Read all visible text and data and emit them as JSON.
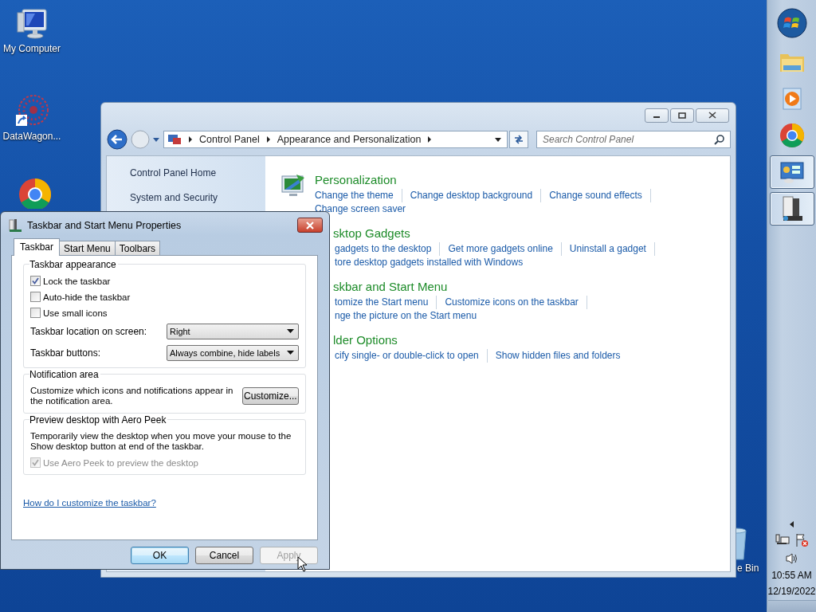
{
  "desktop": {
    "icons": [
      {
        "kind": "computer",
        "label": "My Computer"
      },
      {
        "kind": "app",
        "label": "DataWagon..."
      },
      {
        "kind": "browser"
      },
      {
        "kind": "recycle-bin",
        "label": "e Bin"
      }
    ]
  },
  "control_panel": {
    "breadcrumb": [
      "Control Panel",
      "Appearance and Personalization"
    ],
    "search": {
      "placeholder": "Search Control Panel"
    },
    "nav": [
      "Control Panel Home",
      "System and Security"
    ],
    "categories": [
      {
        "title": "Personalization",
        "cut": false,
        "rows": [
          [
            "Change the theme",
            "Change desktop background",
            "Change sound effects"
          ],
          [
            "Change screen saver"
          ]
        ]
      },
      {
        "title": "sktop Gadgets",
        "cut": true,
        "rows": [
          [
            "gadgets to the desktop",
            "Get more gadgets online",
            "Uninstall a gadget"
          ],
          [
            "tore desktop gadgets installed with Windows"
          ]
        ]
      },
      {
        "title": "skbar and Start Menu",
        "cut": true,
        "rows": [
          [
            "tomize the Start menu",
            "Customize icons on the taskbar"
          ],
          [
            "nge the picture on the Start menu"
          ]
        ]
      },
      {
        "title": "lder Options",
        "cut": true,
        "rows": [
          [
            "cify single- or double-click to open",
            "Show hidden files and folders"
          ]
        ]
      }
    ]
  },
  "dialog": {
    "title": "Taskbar and Start Menu Properties",
    "tabs": [
      {
        "label": "Taskbar",
        "selected": true
      },
      {
        "label": "Start Menu",
        "selected": false
      },
      {
        "label": "Toolbars",
        "selected": false
      }
    ],
    "appearance": {
      "title": "Taskbar appearance",
      "options": [
        {
          "label": "Lock the taskbar",
          "checked": true,
          "disabled": false
        },
        {
          "label": "Auto-hide the taskbar",
          "checked": false,
          "disabled": false
        },
        {
          "label": "Use small icons",
          "checked": false,
          "disabled": false
        }
      ],
      "dropdowns": [
        {
          "label": "Taskbar location on screen:",
          "value": "Right"
        },
        {
          "label": "Taskbar buttons:",
          "value": "Always combine, hide labels"
        }
      ]
    },
    "notification": {
      "title": "Notification area",
      "text": "Customize which icons and notifications appear in the notification area.",
      "button": "Customize..."
    },
    "peek": {
      "title": "Preview desktop with Aero Peek",
      "text": "Temporarily view the desktop when you move your mouse to the Show desktop button at end of the taskbar.",
      "option": {
        "label": "Use Aero Peek to preview the desktop",
        "checked": true,
        "disabled": true
      }
    },
    "help_link": "How do I customize the taskbar?",
    "buttons": [
      {
        "label": "OK",
        "default": true,
        "disabled": false
      },
      {
        "label": "Cancel",
        "default": false,
        "disabled": false
      },
      {
        "label": "Apply",
        "default": false,
        "disabled": true
      }
    ]
  },
  "taskbar": {
    "items": [
      {
        "kind": "start"
      },
      {
        "kind": "folder",
        "running": false
      },
      {
        "kind": "media",
        "running": false
      },
      {
        "kind": "browser",
        "running": false
      },
      {
        "kind": "control-panel",
        "running": true
      },
      {
        "kind": "server",
        "running": true
      }
    ],
    "clock": {
      "time": "10:55 AM",
      "date": "12/19/2022"
    }
  }
}
